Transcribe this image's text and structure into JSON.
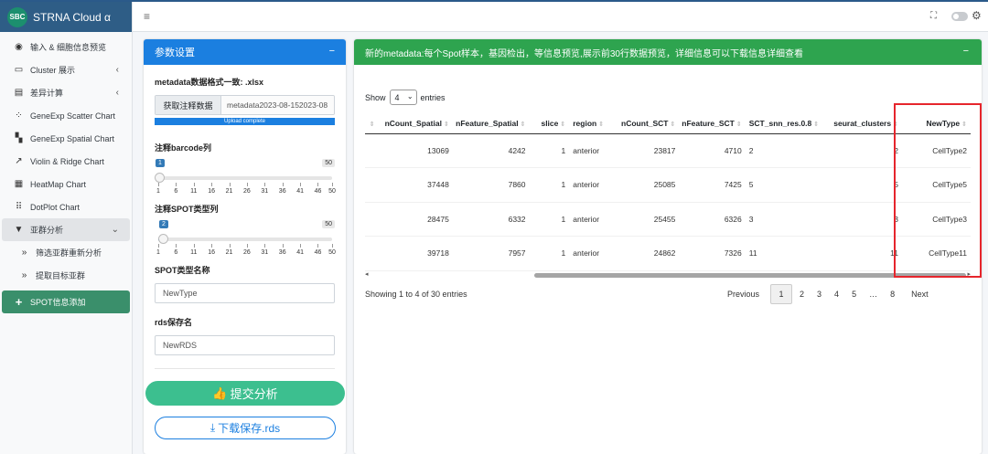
{
  "brand": {
    "logo": "SBC",
    "title": "STRNA Cloud α"
  },
  "sidebar": {
    "items": [
      {
        "icon": "eye-icon",
        "glyph": "◉",
        "label": "输入 & 细胞信息预览"
      },
      {
        "icon": "monitor-icon",
        "glyph": "▭",
        "label": "Cluster 展示",
        "chevron": "‹"
      },
      {
        "icon": "document-icon",
        "glyph": "▤",
        "label": "差异计算",
        "chevron": "‹"
      },
      {
        "icon": "scatter-icon",
        "glyph": "⁘",
        "label": "GeneExp Scatter Chart"
      },
      {
        "icon": "map-icon",
        "glyph": "▚",
        "label": "GeneExp Spatial Chart"
      },
      {
        "icon": "line-chart-icon",
        "glyph": "↗",
        "label": "Violin & Ridge Chart"
      },
      {
        "icon": "grid-icon",
        "glyph": "▦",
        "label": "HeatMap Chart"
      },
      {
        "icon": "dots-grid-icon",
        "glyph": "⠿",
        "label": "DotPlot Chart"
      },
      {
        "icon": "filter-icon",
        "glyph": "▼",
        "label": "亚群分析",
        "chevron": "⌄"
      },
      {
        "icon": "double-chevron-icon",
        "glyph": "»",
        "label": "筛选亚群重新分析"
      },
      {
        "icon": "double-chevron-icon",
        "glyph": "»",
        "label": "提取目标亚群"
      },
      {
        "icon": "plus-icon",
        "glyph": "+",
        "label": "SPOT信息添加"
      }
    ]
  },
  "header": {
    "menu_glyph": "≡",
    "expand_glyph": "⛶",
    "gear_glyph": "⚙"
  },
  "params": {
    "title": "参数设置",
    "minimize": "−",
    "metadata_label": "metadata数据格式一致: .xlsx",
    "file_button": "获取注释数据",
    "file_name": "metadata2023-08-152023-08",
    "upload_status": "Upload complete",
    "barcode_label": "注释barcode列",
    "barcode_value": "1",
    "barcode_max": "50",
    "spot_label": "注释SPOT类型列",
    "spot_value": "2",
    "spot_max": "50",
    "ticks": [
      "1",
      "6",
      "11",
      "16",
      "21",
      "26",
      "31",
      "36",
      "41",
      "46",
      "50"
    ],
    "spot_name_label": "SPOT类型名称",
    "spot_name_value": "NewType",
    "rds_label": "rds保存名",
    "rds_value": "NewRDS",
    "submit": "提交分析",
    "download": "下载保存.rds"
  },
  "preview": {
    "title": "新的metadata:每个Spot样本，基因检出，等信息预览,展示前30行数据预览，详细信息可以下载信息详细查看",
    "minimize": "−",
    "show_label": "Show",
    "show_value": "4",
    "entries_label": "entries",
    "columns": [
      "",
      "nCount_Spatial",
      "nFeature_Spatial",
      "slice",
      "region",
      "nCount_SCT",
      "nFeature_SCT",
      "SCT_snn_res.0.8",
      "seurat_clusters",
      "NewType"
    ],
    "rows": [
      [
        "",
        "13069",
        "4242",
        "1",
        "anterior",
        "23817",
        "4710",
        "2",
        "2",
        "CellType2"
      ],
      [
        "",
        "37448",
        "7860",
        "1",
        "anterior",
        "25085",
        "7425",
        "5",
        "5",
        "CellType5"
      ],
      [
        "",
        "28475",
        "6332",
        "1",
        "anterior",
        "25455",
        "6326",
        "3",
        "3",
        "CellType3"
      ],
      [
        "",
        "39718",
        "7957",
        "1",
        "anterior",
        "24862",
        "7326",
        "11",
        "11",
        "CellType11"
      ]
    ],
    "info": "Showing 1 to 4 of 30 entries",
    "pagination": [
      "Previous",
      "1",
      "2",
      "3",
      "4",
      "5",
      "…",
      "8",
      "Next"
    ],
    "active_page": "1"
  },
  "colors": {
    "brand": "#2e5d86",
    "active_nav": "#3a8f6b",
    "params_header": "#1b7fe0",
    "preview_header": "#2ea44f",
    "submit": "#3cbf8f",
    "highlight_box": "#e6252c"
  }
}
